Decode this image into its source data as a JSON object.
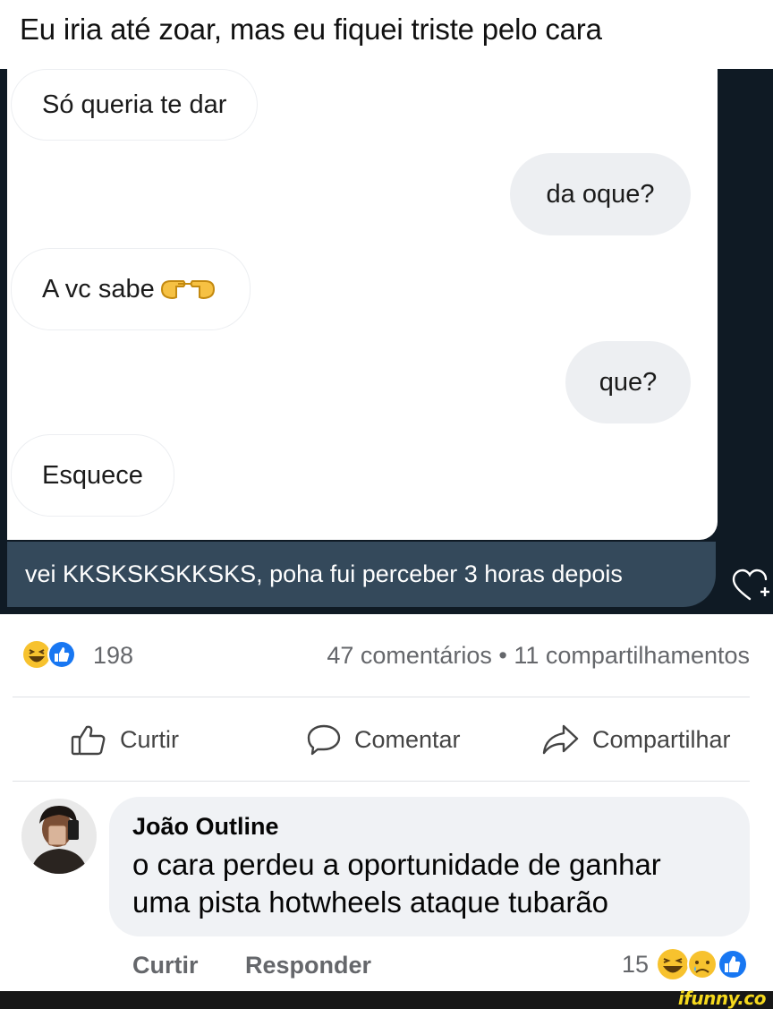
{
  "caption": "Eu iria até zoar, mas eu fiquei triste pelo cara",
  "chat": {
    "messages": [
      {
        "side": "in",
        "text": "Só queria te dar"
      },
      {
        "side": "out",
        "text": "da oque?"
      },
      {
        "side": "in",
        "text": "A vc sabe",
        "emoji": "pointing-hands"
      },
      {
        "side": "out",
        "text": "que?"
      },
      {
        "side": "in",
        "text": "Esquece"
      }
    ],
    "reply": "vei KKSKSKSKKSKS, poha fui perceber 3 horas depois"
  },
  "post": {
    "reaction_count": "198",
    "stats": "47 comentários • 11 compartilhamentos",
    "actions": {
      "like": "Curtir",
      "comment": "Comentar",
      "share": "Compartilhar"
    }
  },
  "comment": {
    "author": "João Outline",
    "text_line1": "o cara perdeu a oportunidade de ganhar",
    "text_line2": "uma pista hotwheels ataque tubarão",
    "like": "Curtir",
    "reply": "Responder",
    "reaction_count": "15"
  },
  "watermark": "ifunny.co",
  "colors": {
    "chat_bg": "#0f1a24",
    "reply_bar": "#34495b",
    "meta_gray": "#65676b",
    "like_blue": "#1877f2"
  }
}
